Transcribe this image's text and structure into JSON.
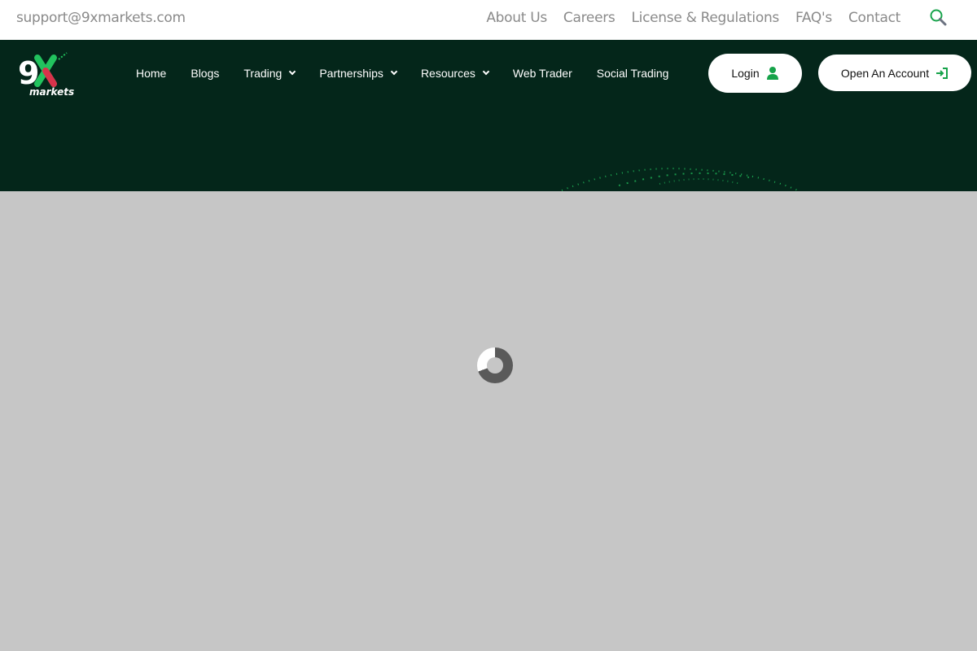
{
  "topbar": {
    "email": "support@9xmarkets.com",
    "links": [
      "About Us",
      "Careers",
      "License & Regulations",
      "FAQ's",
      "Contact"
    ],
    "search_icon": "search-icon"
  },
  "brand": {
    "logo_text": "9X markets",
    "colors": {
      "green": "#22c35e",
      "dark": "#04261a",
      "red": "#d8334b"
    }
  },
  "nav": {
    "items": [
      {
        "label": "Home"
      },
      {
        "label": "Blogs"
      },
      {
        "label": "Trading",
        "dropdown": true
      },
      {
        "label": "Partnerships",
        "dropdown": true
      },
      {
        "label": "Resources",
        "dropdown": true
      },
      {
        "label": "Web Trader"
      },
      {
        "label": "Social Trading"
      }
    ],
    "login_label": "Login",
    "open_account_label": "Open An Account"
  },
  "overlay": {
    "state": "loading"
  }
}
